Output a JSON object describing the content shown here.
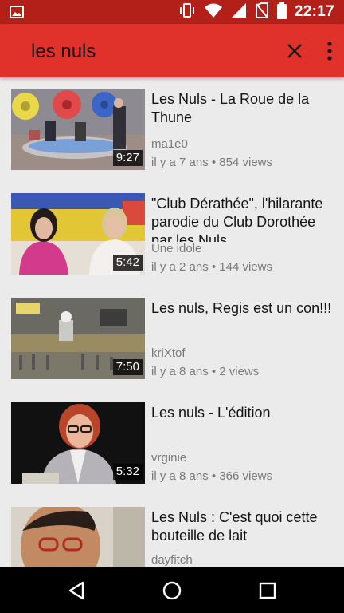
{
  "status_bar": {
    "time": "22:17"
  },
  "search": {
    "query": "les nuls"
  },
  "videos": [
    {
      "title": "Les Nuls - La Roue de la Thune",
      "channel": "ma1e0",
      "meta": "il y a 7 ans • 854 views",
      "duration": "9:27"
    },
    {
      "title": "\"Club Dérathée\", l'hilarante parodie du Club Dorothée par les Nuls",
      "channel": "Une idole",
      "meta": "il y a 2 ans • 144 views",
      "duration": "5:42"
    },
    {
      "title": "Les nuls, Regis est un con!!!",
      "channel": "kriXtof",
      "meta": "il y a 8 ans • 2 views",
      "duration": "7:50"
    },
    {
      "title": "Les nuls - L'édition",
      "channel": "vrginie",
      "meta": "il y a 8 ans • 366 views",
      "duration": "5:32"
    },
    {
      "title": "Les Nuls : C'est quoi cette bouteille de lait",
      "channel": "dayfitch",
      "meta": "",
      "duration": ""
    }
  ],
  "colors": {
    "status_bar": "#b3201a",
    "toolbar": "#e0312b",
    "background": "#ebebeb"
  },
  "icons": [
    "image-icon",
    "vibrate-icon",
    "wifi-icon",
    "signal-icon",
    "no-sim-icon",
    "battery-icon",
    "close-icon",
    "more-vert-icon",
    "back-icon",
    "home-icon",
    "recents-icon"
  ]
}
